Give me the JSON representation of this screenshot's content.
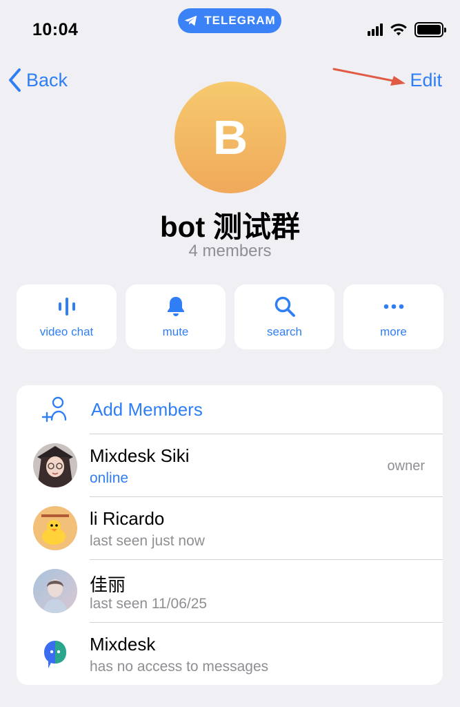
{
  "status_bar": {
    "time": "10:04",
    "app_pill": "TELEGRAM"
  },
  "nav": {
    "back_label": "Back",
    "edit_label": "Edit"
  },
  "profile": {
    "avatar_letter": "B",
    "name": "bot 测试群",
    "members_count": "4 members",
    "avatar_color": "#f3b862"
  },
  "actions": [
    {
      "label": "video chat",
      "icon": "video-chat-icon"
    },
    {
      "label": "mute",
      "icon": "bell-icon"
    },
    {
      "label": "search",
      "icon": "search-icon"
    },
    {
      "label": "more",
      "icon": "more-dots-icon"
    }
  ],
  "members": {
    "add_label": "Add Members",
    "list": [
      {
        "name": "Mixdesk Siki",
        "status": "online",
        "role": "owner"
      },
      {
        "name": "li Ricardo",
        "status": "last seen just now"
      },
      {
        "name": "佳丽",
        "status": "last seen 11/06/25"
      },
      {
        "name": "Mixdesk",
        "status": "has no access to messages"
      }
    ]
  },
  "colors": {
    "accent": "#2f7ef5",
    "background": "#efeff4",
    "annotation_arrow": "#e05a44"
  }
}
